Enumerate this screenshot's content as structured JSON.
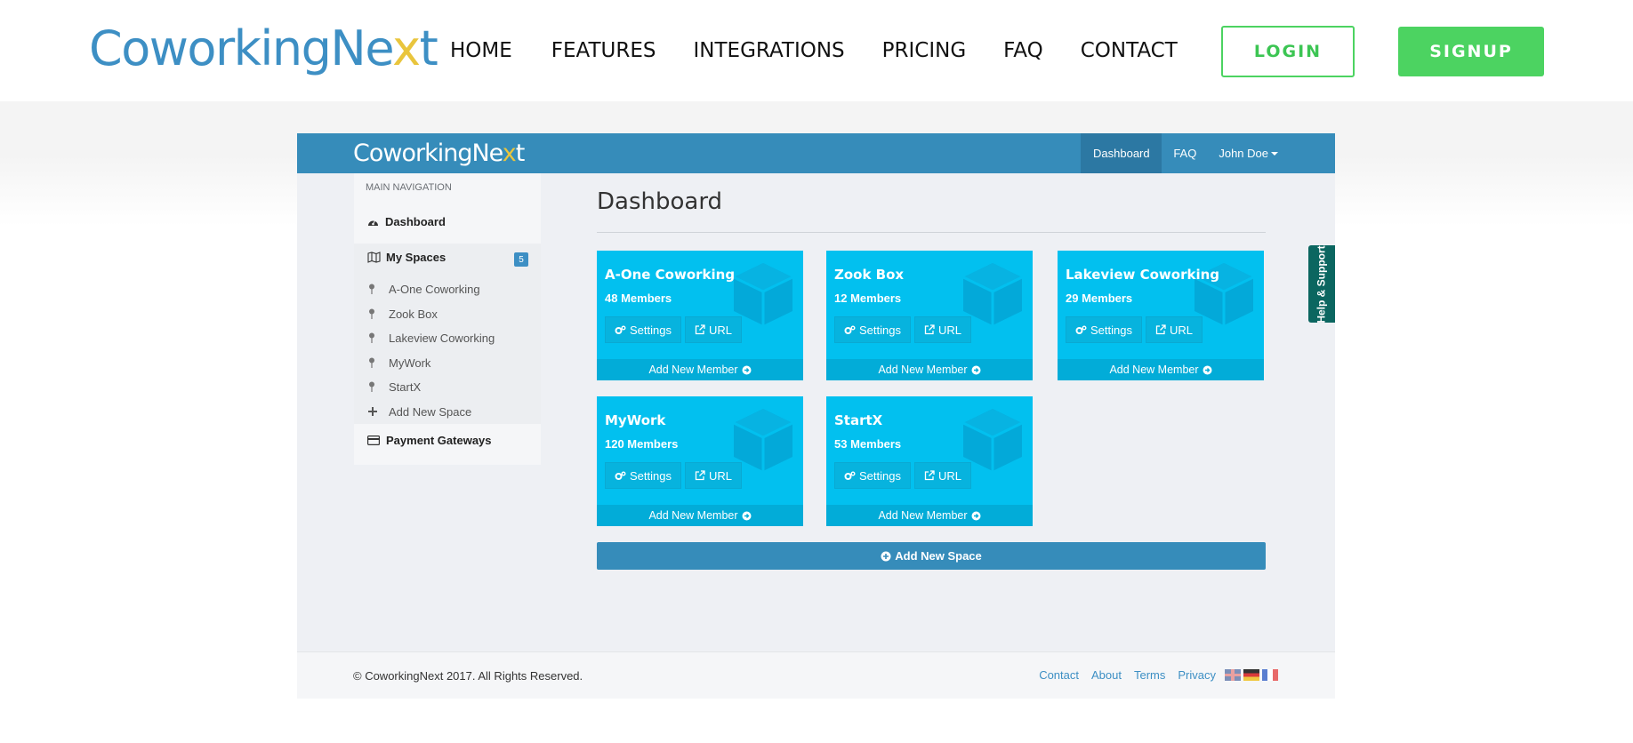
{
  "site": {
    "logo_main": "CoworkingNe",
    "logo_x": "x",
    "logo_end": "t",
    "nav": [
      "HOME",
      "FEATURES",
      "INTEGRATIONS",
      "PRICING",
      "FAQ",
      "CONTACT"
    ],
    "login_label": "LOGIN",
    "signup_label": "SIGNUP"
  },
  "app": {
    "logo_main": "CoworkingNe",
    "logo_x": "x",
    "logo_end": "t",
    "nav": {
      "dashboard": "Dashboard",
      "faq": "FAQ",
      "user": "John Doe"
    },
    "sidebar": {
      "header": "MAIN NAVIGATION",
      "dashboard": "Dashboard",
      "my_spaces": "My Spaces",
      "badge": "5",
      "items": [
        "A-One Coworking",
        "Zook Box",
        "Lakeview Coworking",
        "MyWork",
        "StartX"
      ],
      "add_new_space": "Add New Space",
      "payment_gateways": "Payment Gateways"
    },
    "page_title": "Dashboard",
    "cards": [
      {
        "name": "A-One Coworking",
        "members": "48 Members",
        "settings": "Settings",
        "url": "URL",
        "add_member": "Add New Member"
      },
      {
        "name": "Zook Box",
        "members": "12 Members",
        "settings": "Settings",
        "url": "URL",
        "add_member": "Add New Member"
      },
      {
        "name": "Lakeview Coworking",
        "members": "29 Members",
        "settings": "Settings",
        "url": "URL",
        "add_member": "Add New Member"
      },
      {
        "name": "MyWork",
        "members": "120 Members",
        "settings": "Settings",
        "url": "URL",
        "add_member": "Add New Member"
      },
      {
        "name": "StartX",
        "members": "53 Members",
        "settings": "Settings",
        "url": "URL",
        "add_member": "Add New Member"
      }
    ],
    "add_new_space_button": "Add New Space",
    "help_tab": "Help & Support",
    "footer": {
      "copyright": "© CoworkingNext 2017. All Rights Reserved.",
      "links": [
        "Contact",
        "About",
        "Terms",
        "Privacy"
      ],
      "flags": [
        "uk-flag",
        "germany-flag",
        "france-flag"
      ]
    }
  },
  "colors": {
    "brand_blue": "#368cba",
    "card_cyan": "#02c0ef",
    "signup_green": "#4cd361",
    "logo_accent": "#e9c53d",
    "help_teal": "#0b6660"
  }
}
